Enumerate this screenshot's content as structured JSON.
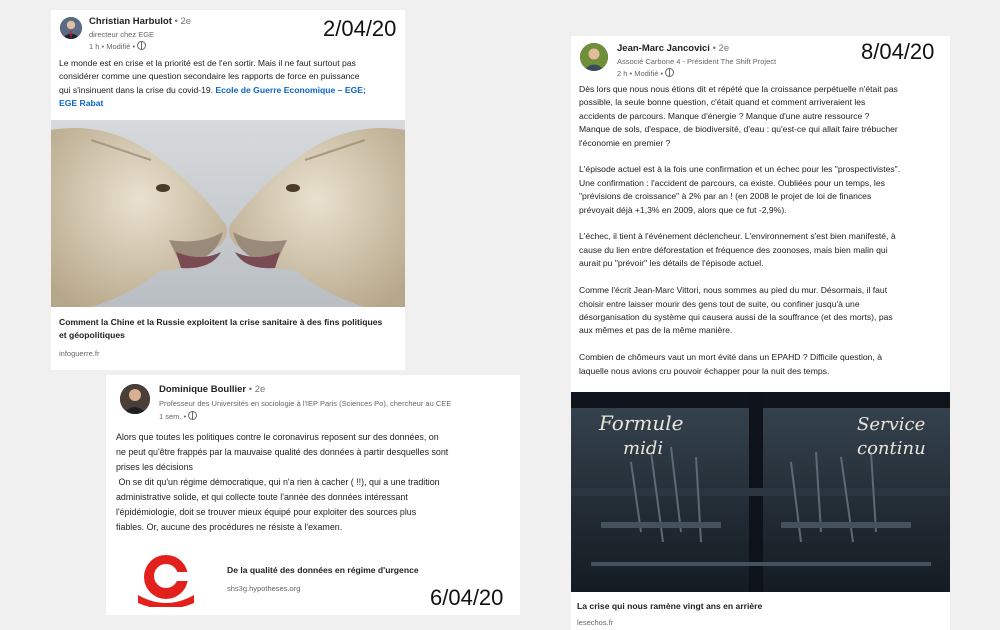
{
  "post1": {
    "author": "Christian Harbulot",
    "degree": "• 2e",
    "role": "directeur chez EGE",
    "meta": "1 h • Modifié •",
    "date_stamp": "2/04/20",
    "text_lines": [
      "Le monde est en crise  et la priorité est de l'en sortir. Mais il ne faut surtout pas",
      "considérer comme une question secondaire les rapports de force en puissance",
      "qui s'insinuent dans la crise du covid-19."
    ],
    "link_text_inline": "Ecole de Guerre Economique – EGE;",
    "link_text_line2": "EGE Rabat",
    "article_title_lines": [
      "Comment la Chine et la Russie exploitent la crise sanitaire à des fins politiques",
      "et géopolitiques"
    ],
    "article_domain": "infoguerre.fr"
  },
  "post2": {
    "author": "Jean-Marc Jancovici",
    "degree": "• 2e",
    "role": "Associé Carbone 4 - Président The Shift Project",
    "meta": "2 h • Modifié •",
    "date_stamp": "8/04/20",
    "paragraphs": [
      [
        "Dès lors que nous nous étions dit et répété que la croissance perpétuelle n'était pas",
        "possible, la seule bonne question, c'était quand et comment arriveraient les",
        "accidents de parcours. Manque d'énergie ? Manque d'une autre ressource ?",
        "Manque de sols, d'espace, de biodiversité, d'eau : qu'est-ce qui allait faire trébucher",
        "l'économie en premier ?"
      ],
      [
        "L'épisode actuel est à la fois une confirmation et un échec pour les \"prospectivistes\".",
        "Une confirmation : l'accident de parcours, ca existe. Oubliées pour un temps, les",
        "\"prévisions de croissance\" à 2% par an ! (en 2008 le projet de loi de finances",
        "prévoyait déjà +1,3% en 2009, alors que ce fut -2,9%)."
      ],
      [
        "L'échec, il tient à l'événement déclencheur. L'environnement s'est bien manifesté, à",
        "cause du lien entre déforestation et fréquence des zoonoses, mais bien malin qui",
        "aurait pu \"prévoir\" les détails de l'épisode actuel."
      ],
      [
        "Comme l'écrit Jean-Marc Vittori, nous sommes au pied du mur. Désormais, il faut",
        "choisir entre laisser mourir des gens tout de suite, ou confiner jusqu'à une",
        "désorganisation du système qui causera aussi de la souffrance (et des morts), pas",
        "aux mêmes et pas de la même manière."
      ],
      [
        "Combien de chômeurs vaut un mort évité dans un EPAHD ? Difficile question, à",
        "laquelle nous avions cru pouvoir échapper pour la nuit des temps."
      ]
    ],
    "image_text_left_1": "Formule",
    "image_text_left_2": "midi",
    "image_text_right_1": "Service",
    "image_text_right_2": "continu",
    "article_title": "La crise qui nous ramène vingt ans en arrière",
    "article_domain": "lesechos.fr"
  },
  "post3": {
    "author": "Dominique Boullier",
    "degree": "• 2e",
    "role": "Professeur des Universités en sociologie à l'IEP Paris (Sciences Po), chercheur au CEE",
    "meta": "1 sem. •",
    "date_stamp": "6/04/20",
    "text_lines": [
      "Alors que toutes les politiques contre le coronavirus reposent sur des données, on",
      "ne peut qu'être frappés par la mauvaise qualité des données à partir desquelles sont",
      "prises les décisions",
      " On se dit qu'un régime démocratique, qui n'a rien à cacher ( !!), qui a une tradition",
      "administrative solide, et qui collecte toute l'année des données intéressant",
      "l'épidémiologie, doit se trouver mieux équipé pour exploiter des sources plus",
      "fiables. Or, aucune des procédures ne résiste à l'examen."
    ],
    "article_title": "De la qualité des données en régime d'urgence",
    "article_domain": "shs3g.hypotheses.org"
  }
}
